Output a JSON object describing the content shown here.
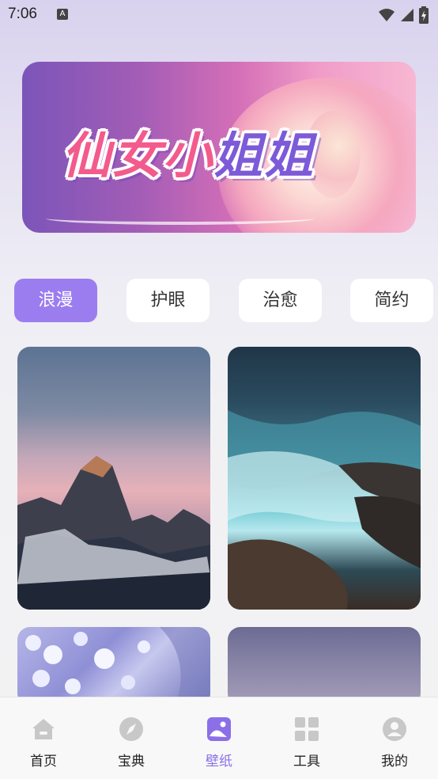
{
  "status_bar": {
    "time": "7:06",
    "notification_icon": "a-icon"
  },
  "banner": {
    "logo_text_pink": "仙女小",
    "logo_text_purple": "姐姐"
  },
  "tabs": [
    {
      "label": "浪漫",
      "active": true
    },
    {
      "label": "护眼",
      "active": false
    },
    {
      "label": "治愈",
      "active": false
    },
    {
      "label": "简约",
      "active": false
    }
  ],
  "wallpapers": [
    "mountain-dusk",
    "ocean-waves",
    "flower-branches",
    "purple-sky"
  ],
  "bottom_nav": [
    {
      "label": "首页",
      "icon": "home-icon",
      "active": false
    },
    {
      "label": "宝典",
      "icon": "compass-icon",
      "active": false
    },
    {
      "label": "壁纸",
      "icon": "wallpaper-icon",
      "active": true
    },
    {
      "label": "工具",
      "icon": "grid-icon",
      "active": false
    },
    {
      "label": "我的",
      "icon": "profile-icon",
      "active": false
    }
  ],
  "colors": {
    "accent": "#9b7df0",
    "nav_active": "#8b6fe8",
    "nav_inactive_icon": "#c8c8c8"
  }
}
